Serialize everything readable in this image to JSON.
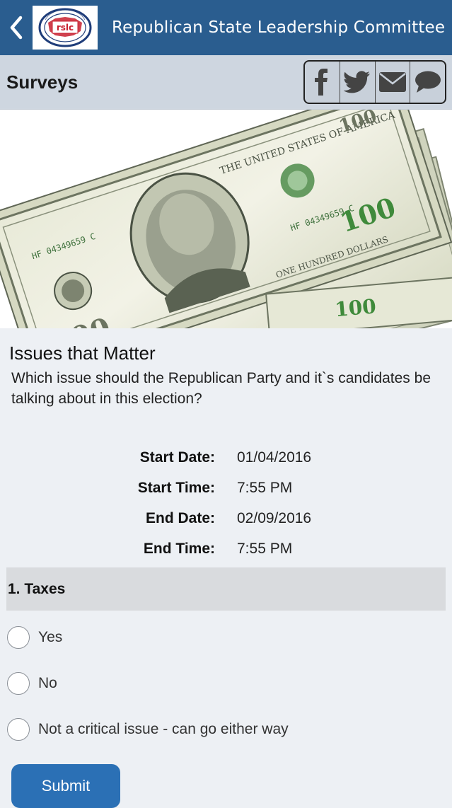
{
  "header": {
    "title": "Republican State Leadership Committee",
    "back_icon": "chevron-left-icon",
    "logo_text": "rslc",
    "logo_ring_text": "REPUBLICAN STATE LEADERSHIP COMMITTEE",
    "bg_color": "#2a5d8f"
  },
  "subheader": {
    "title": "Surveys",
    "share_icons": [
      "facebook-icon",
      "twitter-icon",
      "mail-icon",
      "chat-bubble-icon"
    ]
  },
  "hero": {
    "image_subject": "hundred-dollar-bills",
    "note_text": "100",
    "serial": "HF 04349659 C",
    "mini_text": "THE UNITED STATES OF AMERICA",
    "series_text": "ONE HUNDRED DOLLARS"
  },
  "survey": {
    "title": "Issues that Matter",
    "question": "Which issue should the Republican Party and it`s candidates be talking about in this election?",
    "meta": [
      {
        "label": "Start Date:",
        "value": "01/04/2016"
      },
      {
        "label": "Start Time:",
        "value": "7:55 PM"
      },
      {
        "label": "End Date:",
        "value": "02/09/2016"
      },
      {
        "label": "End Time:",
        "value": "7:55 PM"
      }
    ],
    "question_item": {
      "label": "1. Taxes",
      "options": [
        "Yes",
        "No",
        "Not a critical issue - can go either way"
      ]
    },
    "submit_label": "Submit",
    "accent_color": "#2b70b5"
  }
}
